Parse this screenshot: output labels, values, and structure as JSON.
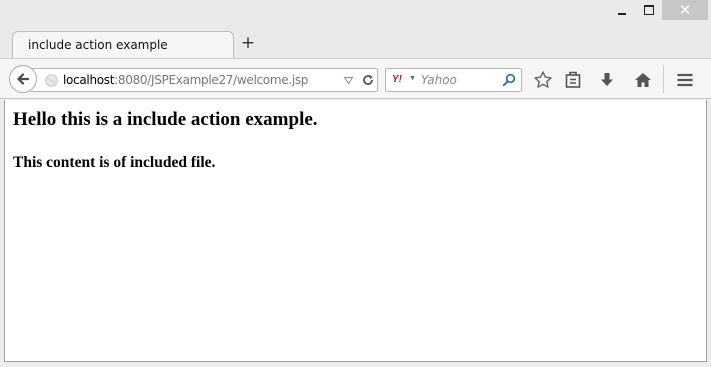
{
  "tab": {
    "title": "include action example",
    "new_tab_label": "+"
  },
  "window_controls": {
    "close_label": "✕"
  },
  "urlbar": {
    "host": "localhost",
    "rest": ":8080/JSPExample27/welcome.jsp"
  },
  "searchbar": {
    "engine_logo": "Y!",
    "placeholder": "Yahoo"
  },
  "page": {
    "heading": "Hello this is a include action example.",
    "included_text": "This content is of included file."
  },
  "colors": {
    "window_chrome": "#eaeaea",
    "toolbar": "#f6f6f6",
    "close_button": "#c7c7c7",
    "search_engine": "#c8102e",
    "search_icon": "#2b6cb0"
  }
}
